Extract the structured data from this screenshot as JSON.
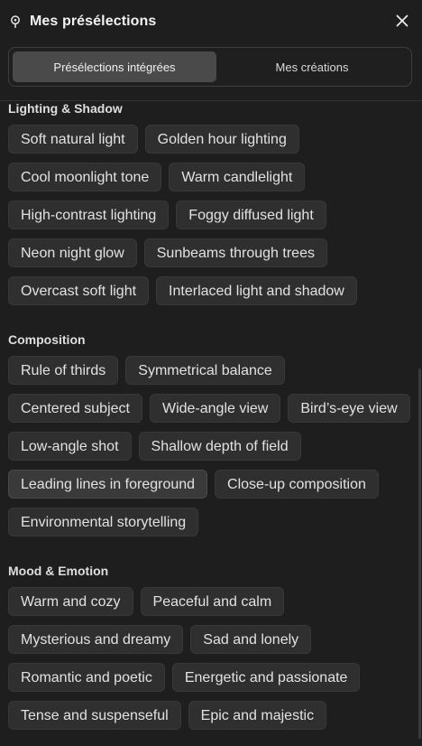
{
  "header": {
    "title": "Mes présélections",
    "pin_icon": "pin-icon",
    "close_icon": "close-icon"
  },
  "tabs": [
    {
      "label": "Présélections intégrées",
      "active": true
    },
    {
      "label": "Mes créations",
      "active": false
    }
  ],
  "sections": [
    {
      "title": "Lighting & Shadow",
      "items": [
        "Soft natural light",
        "Golden hour lighting",
        "Cool moonlight tone",
        "Warm candlelight",
        "High-contrast lighting",
        "Foggy diffused light",
        "Neon night glow",
        "Sunbeams through trees",
        "Overcast soft light",
        "Interlaced light and shadow"
      ]
    },
    {
      "title": "Composition",
      "items": [
        "Rule of thirds",
        "Symmetrical balance",
        "Centered subject",
        "Wide-angle view",
        "Bird’s-eye view",
        "Low-angle shot",
        "Shallow depth of field",
        "Leading lines in foreground",
        "Close-up composition",
        "Environmental storytelling"
      ]
    },
    {
      "title": "Mood & Emotion",
      "items": [
        "Warm and cozy",
        "Peaceful and calm",
        "Mysterious and dreamy",
        "Sad and lonely",
        "Romantic and poetic",
        "Energetic and passionate",
        "Tense and suspenseful",
        "Epic and majestic"
      ]
    }
  ],
  "hovered_item": "Leading lines in foreground"
}
